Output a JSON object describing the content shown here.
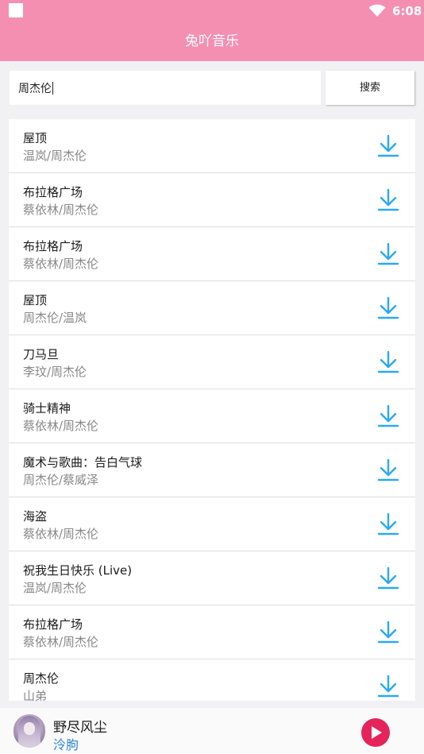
{
  "status_bar": {
    "time": "6:08"
  },
  "app_bar": {
    "title": "兔吖音乐"
  },
  "search": {
    "value": "周杰伦",
    "button_label": "搜索"
  },
  "songs": [
    {
      "title": "屋顶",
      "artist": "温岚/周杰伦"
    },
    {
      "title": "布拉格广场",
      "artist": "蔡依林/周杰伦"
    },
    {
      "title": "布拉格广场",
      "artist": "蔡依林/周杰伦"
    },
    {
      "title": "屋顶",
      "artist": "周杰伦/温岚"
    },
    {
      "title": "刀马旦",
      "artist": "李玟/周杰伦"
    },
    {
      "title": "骑士精神",
      "artist": "蔡依林/周杰伦"
    },
    {
      "title": "魔术与歌曲：告白气球",
      "artist": "周杰伦/蔡威泽"
    },
    {
      "title": "海盗",
      "artist": "蔡依林/周杰伦"
    },
    {
      "title": "祝我生日快乐 (Live)",
      "artist": "温岚/周杰伦"
    },
    {
      "title": "布拉格广场",
      "artist": "蔡依林/周杰伦"
    },
    {
      "title": "周杰伦",
      "artist": "山弟"
    }
  ],
  "player": {
    "title": "野尽风尘",
    "artist": "泠朐"
  },
  "colors": {
    "accent_pink": "#f48fb1",
    "download_blue": "#29a9f3",
    "play_red": "#e4245a",
    "artist_link_blue": "#2f86d8"
  },
  "icons": {
    "download": "download-icon",
    "play": "play-icon",
    "wifi": "wifi-icon"
  }
}
